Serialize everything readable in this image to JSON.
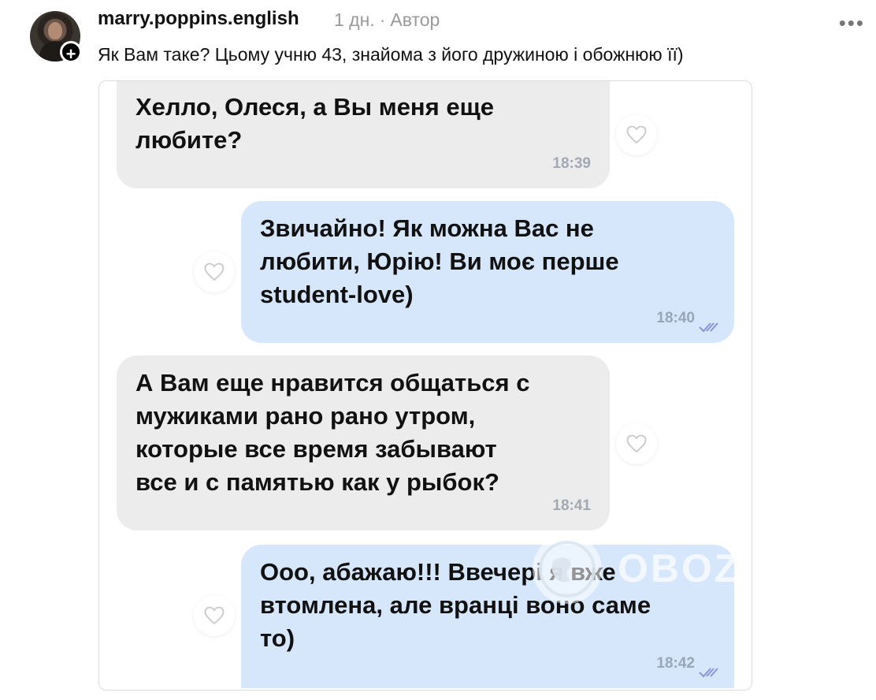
{
  "post": {
    "username": "marry.poppins.english",
    "time_ago": "1 дн.",
    "separator": "·",
    "author_label": "Автор",
    "more_label": "•••",
    "follow_label": "+",
    "caption": "Як Вам таке? Цьому учню 43, знайома з його дружиною і обожнюю її)"
  },
  "chat": {
    "messages": [
      {
        "direction": "incoming",
        "text": "Хелло, Олеся, а Вы меня еще\nлюбите?",
        "time": "18:39"
      },
      {
        "direction": "outgoing",
        "text": "Звичайно! Як можна Вас не\nлюбити, Юрію! Ви моє перше\nstudent-love)",
        "time": "18:40"
      },
      {
        "direction": "incoming",
        "text": "А Вам еще нравится общаться с\nмужиками рано рано утром,\nкоторые все время забывают\nвсе и с памятью как у рыбок?",
        "time": "18:41"
      },
      {
        "direction": "outgoing",
        "text": "Ооо, абажаю!!! Ввечері я вже\nвтомлена, але вранці воно саме\nто)",
        "time": "18:42"
      }
    ]
  },
  "watermark": {
    "text": "OBOZ.UA"
  },
  "colors": {
    "incoming_bubble": "#ececec",
    "outgoing_bubble": "#d6e6fb",
    "read_check": "#8a93d8"
  }
}
